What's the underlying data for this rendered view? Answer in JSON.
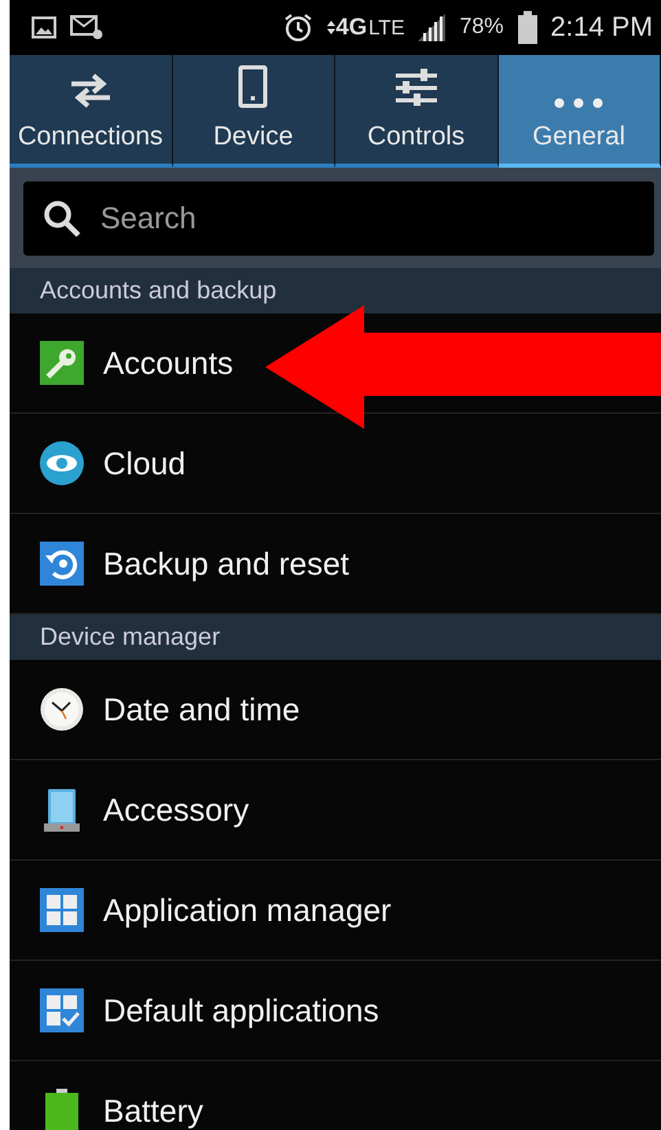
{
  "status_bar": {
    "network": "4G",
    "network_sub": "LTE",
    "battery": "78%",
    "time": "2:14 PM"
  },
  "tabs": [
    {
      "label": "Connections",
      "selected": false
    },
    {
      "label": "Device",
      "selected": false
    },
    {
      "label": "Controls",
      "selected": false
    },
    {
      "label": "General",
      "selected": true
    }
  ],
  "search": {
    "placeholder": "Search"
  },
  "sections": [
    {
      "title": "Accounts and backup",
      "items": [
        {
          "label": "Accounts"
        },
        {
          "label": "Cloud"
        },
        {
          "label": "Backup and reset"
        }
      ]
    },
    {
      "title": "Device manager",
      "items": [
        {
          "label": "Date and time"
        },
        {
          "label": "Accessory"
        },
        {
          "label": "Application manager"
        },
        {
          "label": "Default applications"
        },
        {
          "label": "Battery"
        }
      ]
    }
  ]
}
